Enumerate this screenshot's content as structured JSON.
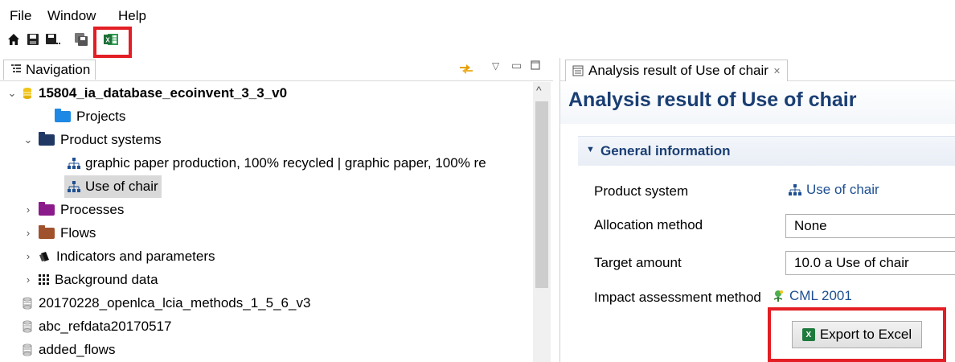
{
  "menubar": {
    "items": [
      "File",
      "Window",
      "Help"
    ]
  },
  "toolbar": {
    "icons": [
      "home-icon",
      "save-icon",
      "save-as-icon",
      "save-all-icon",
      "excel-icon"
    ]
  },
  "navigation": {
    "tab_label": "Navigation",
    "tree": [
      {
        "label": "15804_ia_database_ecoinvent_3_3_v0",
        "bold": true
      },
      {
        "label": "Projects"
      },
      {
        "label": "Product systems"
      },
      {
        "label": "graphic paper production, 100% recycled | graphic paper, 100% re"
      },
      {
        "label": "Use of chair",
        "selected": true
      },
      {
        "label": "Processes"
      },
      {
        "label": "Flows"
      },
      {
        "label": "Indicators and parameters"
      },
      {
        "label": "Background data"
      },
      {
        "label": "20170228_openlca_lcia_methods_1_5_6_v3"
      },
      {
        "label": "abc_refdata20170517"
      },
      {
        "label": "added_flows"
      }
    ],
    "colors": {
      "projects": "#1e88e5",
      "product_systems": "#1f3864",
      "processes": "#8b1a8b",
      "flows": "#a0522d"
    }
  },
  "editor": {
    "tab_label": "Analysis result of Use of chair",
    "tab_close": "✕",
    "title": "Analysis result of Use of chair",
    "section_title": "General information",
    "fields": {
      "product_system_label": "Product system",
      "product_system_value": "Use of chair",
      "allocation_label": "Allocation method",
      "allocation_value": "None",
      "target_label": "Target amount",
      "target_value": "10.0 a Use of chair",
      "impact_label": "Impact assessment method",
      "impact_value": "CML 2001"
    },
    "export_button": "Export to Excel"
  }
}
